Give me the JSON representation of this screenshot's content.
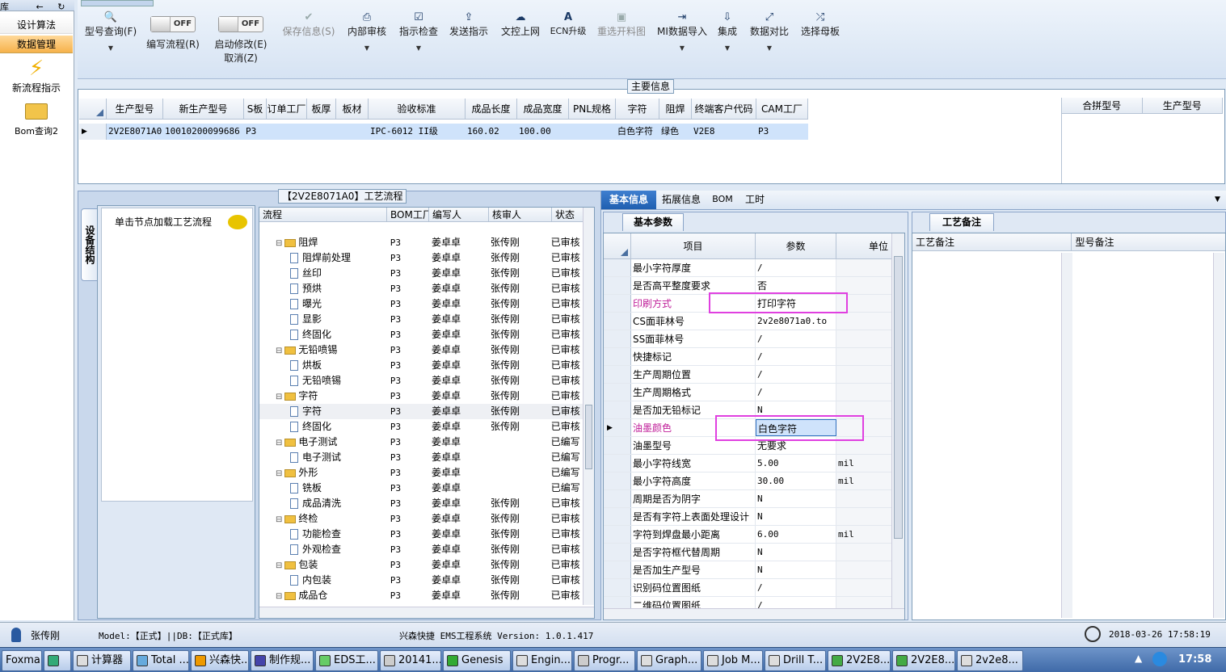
{
  "left_nav": {
    "top_text": "库",
    "items": [
      "设计算法",
      "数据管理"
    ],
    "tiles": [
      "新流程指示",
      "Bom查询2"
    ]
  },
  "toolbar": {
    "buttons": [
      {
        "label": "型号查询(F)",
        "icon": "search-icon"
      },
      {
        "label": "编写流程(R)",
        "icon": "toggle-icon"
      },
      {
        "label": "启动修改(E)",
        "icon": "toggle-icon"
      },
      {
        "label": "保存信息(S)",
        "icon": "check-icon"
      },
      {
        "label": "内部审核",
        "icon": "printer-icon"
      },
      {
        "label": "指示检查",
        "icon": "checkbox-icon"
      },
      {
        "label": "发送指示",
        "icon": "upload-icon"
      },
      {
        "label": "文控上网",
        "icon": "cloud-upload-icon"
      },
      {
        "label": "ECN升级",
        "icon": "text-a-icon"
      },
      {
        "label": "重选开料图",
        "icon": "image-icon"
      },
      {
        "label": "MI数据导入",
        "icon": "import-icon"
      },
      {
        "label": "集成",
        "icon": "download-icon"
      },
      {
        "label": "数据对比",
        "icon": "compare-icon"
      },
      {
        "label": "选择母板",
        "icon": "shuffle-icon"
      }
    ],
    "toggle_text": "OFF",
    "cancel_label": "取消(Z)"
  },
  "main_info": {
    "legend": "主要信息",
    "columns": [
      "生产型号",
      "新生产型号",
      "S板",
      "订单工厂",
      "板厚",
      "板材",
      "验收标准",
      "成品长度",
      "成品宽度",
      "PNL规格",
      "字符",
      "阻焊",
      "终端客户代码",
      "CAM工厂"
    ],
    "row": [
      "2V2E8071A0",
      "10010200099686",
      "P3",
      "",
      "",
      "",
      "IPC-6012 II级",
      "160.02",
      "100.00",
      "",
      "白色字符",
      "绿色",
      "V2E8",
      "P3"
    ],
    "side_columns": [
      "合拼型号",
      "生产型号"
    ]
  },
  "device_panel": {
    "vertical_tab": "设备结构",
    "hint": "单击节点加载工艺流程"
  },
  "flow": {
    "legend": "【2V2E8071A0】工艺流程",
    "columns": [
      "流程",
      "BOM工厂",
      "编写人",
      "核审人",
      "状态"
    ],
    "rows": [
      {
        "level": 1,
        "name": "阻焊",
        "bom": "P3",
        "writer": "姜卓卓",
        "reviewer": "张传刚",
        "status": "已审核"
      },
      {
        "level": 2,
        "name": "阻焊前处理",
        "bom": "P3",
        "writer": "姜卓卓",
        "reviewer": "张传刚",
        "status": "已审核"
      },
      {
        "level": 2,
        "name": "丝印",
        "bom": "P3",
        "writer": "姜卓卓",
        "reviewer": "张传刚",
        "status": "已审核"
      },
      {
        "level": 2,
        "name": "预烘",
        "bom": "P3",
        "writer": "姜卓卓",
        "reviewer": "张传刚",
        "status": "已审核"
      },
      {
        "level": 2,
        "name": "曝光",
        "bom": "P3",
        "writer": "姜卓卓",
        "reviewer": "张传刚",
        "status": "已审核"
      },
      {
        "level": 2,
        "name": "显影",
        "bom": "P3",
        "writer": "姜卓卓",
        "reviewer": "张传刚",
        "status": "已审核"
      },
      {
        "level": 2,
        "name": "终固化",
        "bom": "P3",
        "writer": "姜卓卓",
        "reviewer": "张传刚",
        "status": "已审核"
      },
      {
        "level": 1,
        "name": "无铅喷锡",
        "bom": "P3",
        "writer": "姜卓卓",
        "reviewer": "张传刚",
        "status": "已审核"
      },
      {
        "level": 2,
        "name": "烘板",
        "bom": "P3",
        "writer": "姜卓卓",
        "reviewer": "张传刚",
        "status": "已审核"
      },
      {
        "level": 2,
        "name": "无铅喷锡",
        "bom": "P3",
        "writer": "姜卓卓",
        "reviewer": "张传刚",
        "status": "已审核"
      },
      {
        "level": 1,
        "name": "字符",
        "bom": "P3",
        "writer": "姜卓卓",
        "reviewer": "张传刚",
        "status": "已审核"
      },
      {
        "level": 2,
        "name": "字符",
        "bom": "P3",
        "writer": "姜卓卓",
        "reviewer": "张传刚",
        "status": "已审核"
      },
      {
        "level": 2,
        "name": "终固化",
        "bom": "P3",
        "writer": "姜卓卓",
        "reviewer": "张传刚",
        "status": "已审核"
      },
      {
        "level": 1,
        "name": "电子测试",
        "bom": "P3",
        "writer": "姜卓卓",
        "reviewer": "",
        "status": "已编写"
      },
      {
        "level": 2,
        "name": "电子测试",
        "bom": "P3",
        "writer": "姜卓卓",
        "reviewer": "",
        "status": "已编写"
      },
      {
        "level": 1,
        "name": "外形",
        "bom": "P3",
        "writer": "姜卓卓",
        "reviewer": "",
        "status": "已编写"
      },
      {
        "level": 2,
        "name": "铣板",
        "bom": "P3",
        "writer": "姜卓卓",
        "reviewer": "",
        "status": "已编写"
      },
      {
        "level": 2,
        "name": "成品清洗",
        "bom": "P3",
        "writer": "姜卓卓",
        "reviewer": "张传刚",
        "status": "已审核"
      },
      {
        "level": 1,
        "name": "终检",
        "bom": "P3",
        "writer": "姜卓卓",
        "reviewer": "张传刚",
        "status": "已审核"
      },
      {
        "level": 2,
        "name": "功能检查",
        "bom": "P3",
        "writer": "姜卓卓",
        "reviewer": "张传刚",
        "status": "已审核"
      },
      {
        "level": 2,
        "name": "外观检查",
        "bom": "P3",
        "writer": "姜卓卓",
        "reviewer": "张传刚",
        "status": "已审核"
      },
      {
        "level": 1,
        "name": "包装",
        "bom": "P3",
        "writer": "姜卓卓",
        "reviewer": "张传刚",
        "status": "已审核"
      },
      {
        "level": 2,
        "name": "内包装",
        "bom": "P3",
        "writer": "姜卓卓",
        "reviewer": "张传刚",
        "status": "已审核"
      },
      {
        "level": 1,
        "name": "成品仓",
        "bom": "P3",
        "writer": "姜卓卓",
        "reviewer": "张传刚",
        "status": "已审核"
      }
    ]
  },
  "info_tabs": [
    "基本信息",
    "拓展信息",
    "BOM",
    "工时"
  ],
  "params": {
    "subtab": "基本参数",
    "columns": [
      "项目",
      "参数",
      "单位"
    ],
    "rows": [
      {
        "item": "最小字符厚度",
        "value": "/",
        "unit": ""
      },
      {
        "item": "是否高平整度要求",
        "value": "否",
        "unit": ""
      },
      {
        "item": "印刷方式",
        "value": "打印字符",
        "unit": "",
        "highlight": true
      },
      {
        "item": "CS面菲林号",
        "value": "2v2e8071a0.to",
        "unit": ""
      },
      {
        "item": "SS面菲林号",
        "value": "/",
        "unit": ""
      },
      {
        "item": "快捷标记",
        "value": "/",
        "unit": ""
      },
      {
        "item": "生产周期位置",
        "value": "/",
        "unit": ""
      },
      {
        "item": "生产周期格式",
        "value": "/",
        "unit": ""
      },
      {
        "item": "是否加无铅标记",
        "value": "N",
        "unit": ""
      },
      {
        "item": "油墨颜色",
        "value": "白色字符",
        "unit": "",
        "highlight": true,
        "selected": true
      },
      {
        "item": "油墨型号",
        "value": "无要求",
        "unit": ""
      },
      {
        "item": "最小字符线宽",
        "value": "5.00",
        "unit": "mil"
      },
      {
        "item": "最小字符高度",
        "value": "30.00",
        "unit": "mil"
      },
      {
        "item": "周期是否为阴字",
        "value": "N",
        "unit": ""
      },
      {
        "item": "是否有字符上表面处理设计",
        "value": "N",
        "unit": ""
      },
      {
        "item": "字符到焊盘最小距离",
        "value": "6.00",
        "unit": "mil"
      },
      {
        "item": "是否字符框代替周期",
        "value": "N",
        "unit": ""
      },
      {
        "item": "是否加生产型号",
        "value": "N",
        "unit": ""
      },
      {
        "item": "识别码位置图纸",
        "value": "/",
        "unit": ""
      },
      {
        "item": "二维码位置图纸",
        "value": "/",
        "unit": ""
      }
    ]
  },
  "process_notes": {
    "tab": "工艺备注",
    "columns": [
      "工艺备注",
      "型号备注"
    ]
  },
  "status": {
    "user": "张传刚",
    "model_db": "Model:【正式】||DB:【正式库】",
    "app": "兴森快捷 EMS工程系统 Version: 1.0.1.417",
    "datetime": "2018-03-26 17:58:19"
  },
  "taskbar": {
    "items": [
      "Foxmail",
      "",
      "计算器",
      "Total ...",
      "兴森快...",
      "制作规...",
      "EDS工...",
      "20141...",
      "Genesis",
      "Engin...",
      "Progr...",
      "Graph...",
      "Job M...",
      "Drill T...",
      "2V2E8...",
      "2V2E8...",
      "2v2e8..."
    ],
    "clock": "17:58"
  },
  "colors": {
    "accent": "#2f6fbf",
    "highlight_box": "#e040e0",
    "selected_row": "#cfe3fb"
  }
}
